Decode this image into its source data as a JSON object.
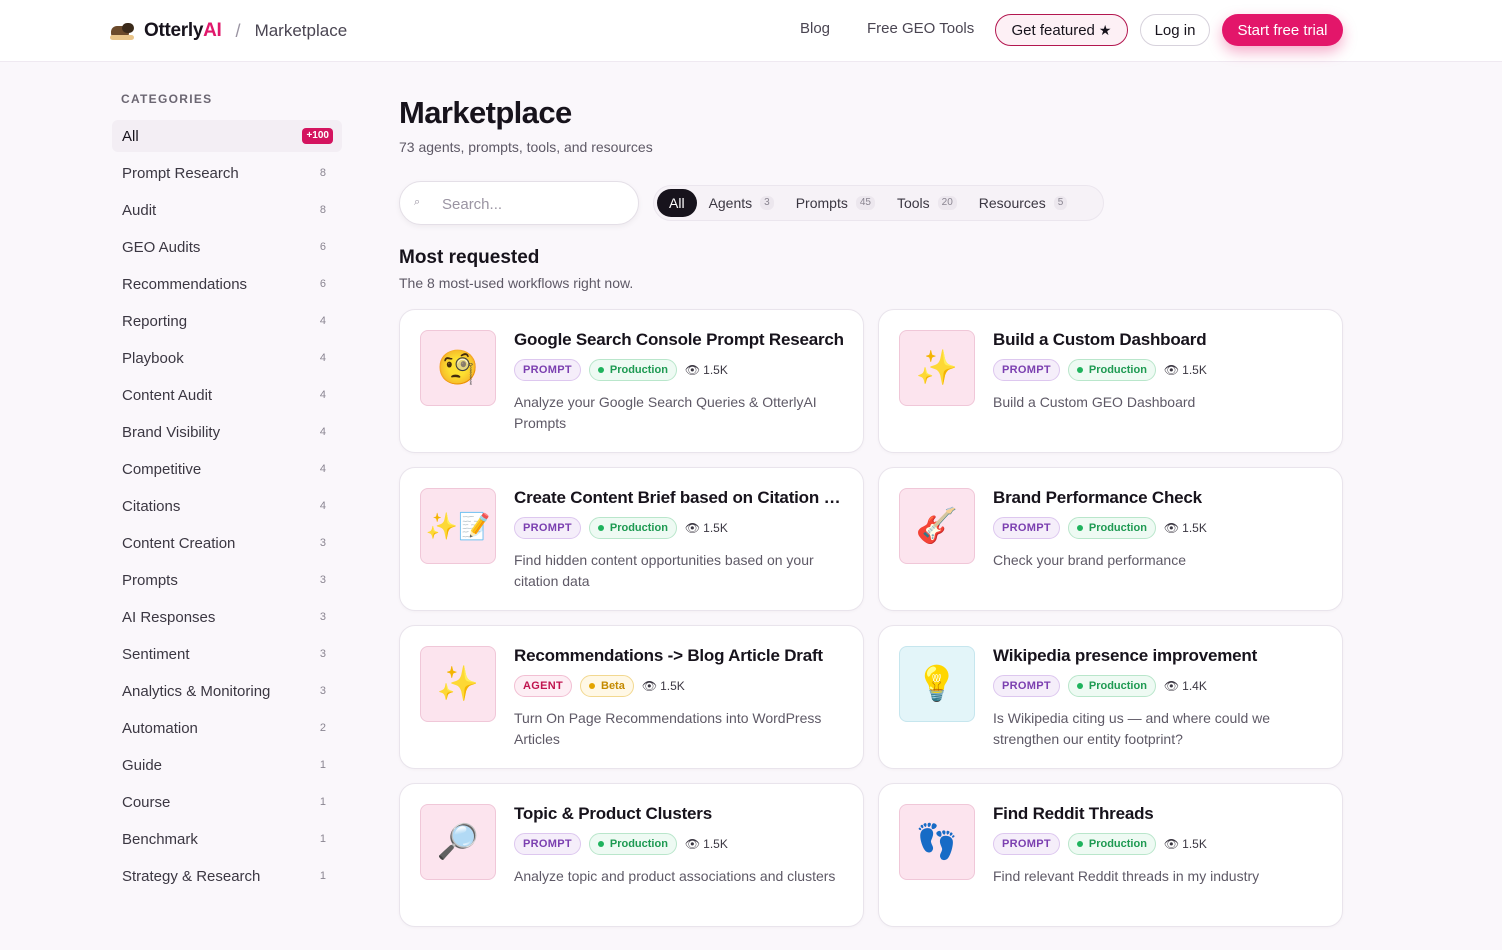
{
  "header": {
    "brand_main": "Otterly",
    "brand_accent": "AI",
    "separator": "/",
    "crumb": "Marketplace",
    "nav": {
      "blog": "Blog",
      "free_tools": "Free GEO Tools"
    },
    "get_featured": "Get featured",
    "login": "Log in",
    "trial": "Start free trial"
  },
  "sidebar": {
    "heading": "CATEGORIES",
    "all": {
      "label": "All",
      "badge": "+100"
    },
    "items": [
      {
        "label": "Prompt Research",
        "count": "8"
      },
      {
        "label": "Audit",
        "count": "8"
      },
      {
        "label": "GEO Audits",
        "count": "6"
      },
      {
        "label": "Recommendations",
        "count": "6"
      },
      {
        "label": "Reporting",
        "count": "4"
      },
      {
        "label": "Playbook",
        "count": "4"
      },
      {
        "label": "Content Audit",
        "count": "4"
      },
      {
        "label": "Brand Visibility",
        "count": "4"
      },
      {
        "label": "Competitive",
        "count": "4"
      },
      {
        "label": "Citations",
        "count": "4"
      },
      {
        "label": "Content Creation",
        "count": "3"
      },
      {
        "label": "Prompts",
        "count": "3"
      },
      {
        "label": "AI Responses",
        "count": "3"
      },
      {
        "label": "Sentiment",
        "count": "3"
      },
      {
        "label": "Analytics & Monitoring",
        "count": "3"
      },
      {
        "label": "Automation",
        "count": "2"
      },
      {
        "label": "Guide",
        "count": "1"
      },
      {
        "label": "Course",
        "count": "1"
      },
      {
        "label": "Benchmark",
        "count": "1"
      },
      {
        "label": "Strategy & Research",
        "count": "1"
      }
    ]
  },
  "main": {
    "title": "Marketplace",
    "subtitle": "73 agents, prompts, tools, and resources",
    "search_placeholder": "Search...",
    "tabs": [
      {
        "label": "All",
        "count": ""
      },
      {
        "label": "Agents",
        "count": "3"
      },
      {
        "label": "Prompts",
        "count": "45"
      },
      {
        "label": "Tools",
        "count": "20"
      },
      {
        "label": "Resources",
        "count": "5"
      }
    ],
    "section_title": "Most requested",
    "section_subtitle": "The 8 most-used workflows right now.",
    "cards": [
      {
        "icon": "🧐",
        "title": "Google Search Console Prompt Research",
        "type": "PROMPT",
        "status": "Production",
        "views": "1.5K",
        "desc": "Analyze your Google Search Queries & OtterlyAI Prompts"
      },
      {
        "icon": "✨",
        "title": "Build a Custom Dashboard",
        "type": "PROMPT",
        "status": "Production",
        "views": "1.5K",
        "desc": "Build a Custom GEO Dashboard"
      },
      {
        "icon": "✨📝",
        "title": "Create Content Brief based on Citation Gaps",
        "type": "PROMPT",
        "status": "Production",
        "views": "1.5K",
        "desc": "Find hidden content opportunities based on your citation data"
      },
      {
        "icon": "🎸",
        "title": "Brand Performance Check",
        "type": "PROMPT",
        "status": "Production",
        "views": "1.5K",
        "desc": "Check your brand performance"
      },
      {
        "icon": "✨",
        "title": "Recommendations -> Blog Article Draft",
        "type": "AGENT",
        "status": "Beta",
        "views": "1.5K",
        "desc": "Turn On Page Recommendations into WordPress Articles"
      },
      {
        "icon": "💡",
        "title": "Wikipedia presence improvement",
        "type": "PROMPT",
        "status": "Production",
        "views": "1.4K",
        "desc": "Is Wikipedia citing us — and where could we strengthen our entity footprint?"
      },
      {
        "icon": "🔎",
        "title": "Topic & Product Clusters",
        "type": "PROMPT",
        "status": "Production",
        "views": "1.5K",
        "desc": "Analyze topic and product associations and clusters"
      },
      {
        "icon": "👣",
        "title": "Find Reddit Threads",
        "type": "PROMPT",
        "status": "Production",
        "views": "1.5K",
        "desc": "Find relevant Reddit threads in my industry"
      }
    ]
  },
  "colors": {
    "accent": "#e3166a",
    "prompt_tag": "#7b3fb0",
    "agent_tag": "#c0144f",
    "production": "#1e9a52",
    "beta": "#c48a00"
  },
  "icons": {
    "search": "search-icon",
    "star": "star-icon",
    "eye": "eye-icon"
  }
}
